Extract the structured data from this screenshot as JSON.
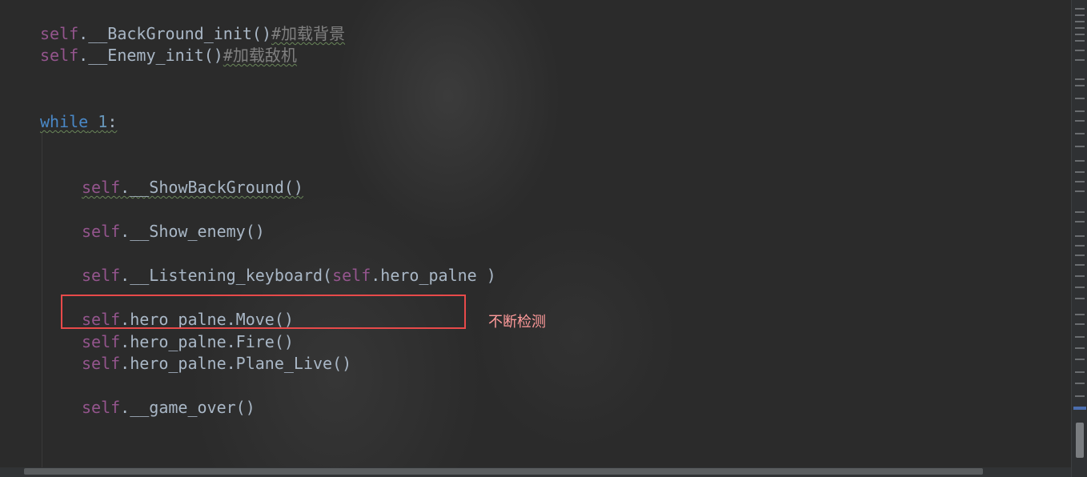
{
  "code_lines": [
    {
      "self": "self",
      "rest": ".__BackGround_init()",
      "comment": "#加载背景"
    },
    {
      "self": "self",
      "rest": ".__Enemy_init()",
      "comment": "#加载敌机"
    },
    {
      "keyword": "while",
      "num": "1",
      "colon": ":"
    },
    {
      "self": "self",
      "rest": ".__ShowBackGround()"
    },
    {
      "self": "self",
      "rest": ".__Show_enemy()"
    },
    {
      "self": "self",
      "rest": ".__Listening_keyboard(",
      "self2": "self",
      "rest2": ".hero_palne",
      "tail": " )"
    },
    {
      "self": "self",
      "rest": ".hero_palne.Move()"
    },
    {
      "self": "self",
      "rest": ".hero_palne.Fire()"
    },
    {
      "self": "self",
      "rest": ".hero_palne.Plane_Live()"
    },
    {
      "self": "self",
      "rest": ".__game_over()"
    }
  ],
  "annotation": "不断检测",
  "colors": {
    "self": "#94558d",
    "keyword": "#4a88c7",
    "comment": "#808080",
    "highlight": "#e84a4a"
  }
}
